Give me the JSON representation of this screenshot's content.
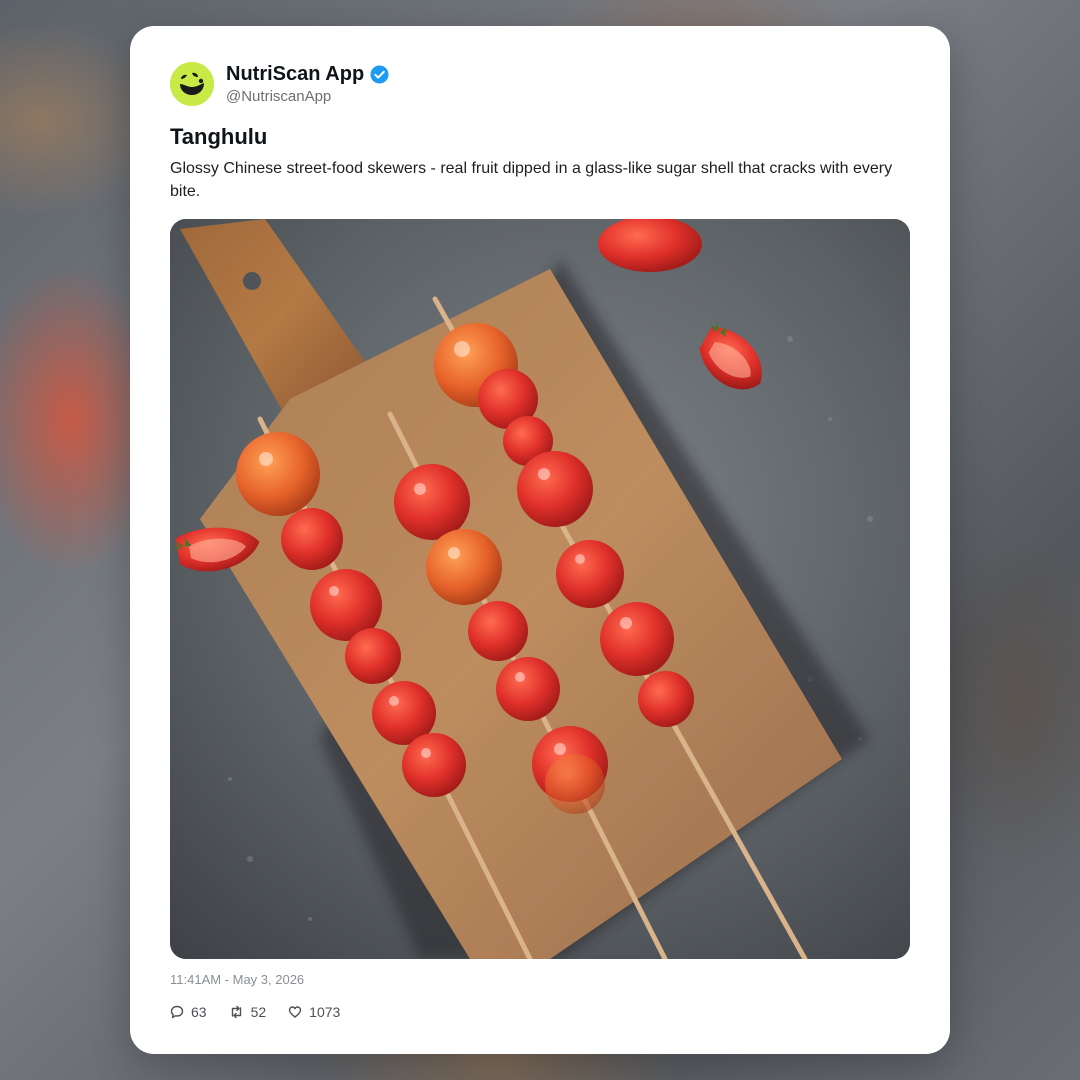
{
  "post": {
    "author": {
      "display_name": "NutriScan App",
      "handle": "@NutriscanApp",
      "verified": true,
      "avatar_icon": "smiling-face-logo-icon",
      "avatar_color": "#c7ea46"
    },
    "title": "Tanghulu",
    "body": "Glossy Chinese street-food skewers - real fruit dipped in a glass-like sugar shell that cracks with every bite.",
    "image_icon": "tanghulu-strawberry-skewers-photo",
    "timestamp": "11:41AM - May 3, 2026",
    "stats": {
      "replies": "63",
      "reposts": "52",
      "likes": "1073"
    }
  },
  "colors": {
    "verified_badge": "#1d9bf0",
    "text_primary": "#0f1419",
    "text_secondary": "#6b7075"
  }
}
